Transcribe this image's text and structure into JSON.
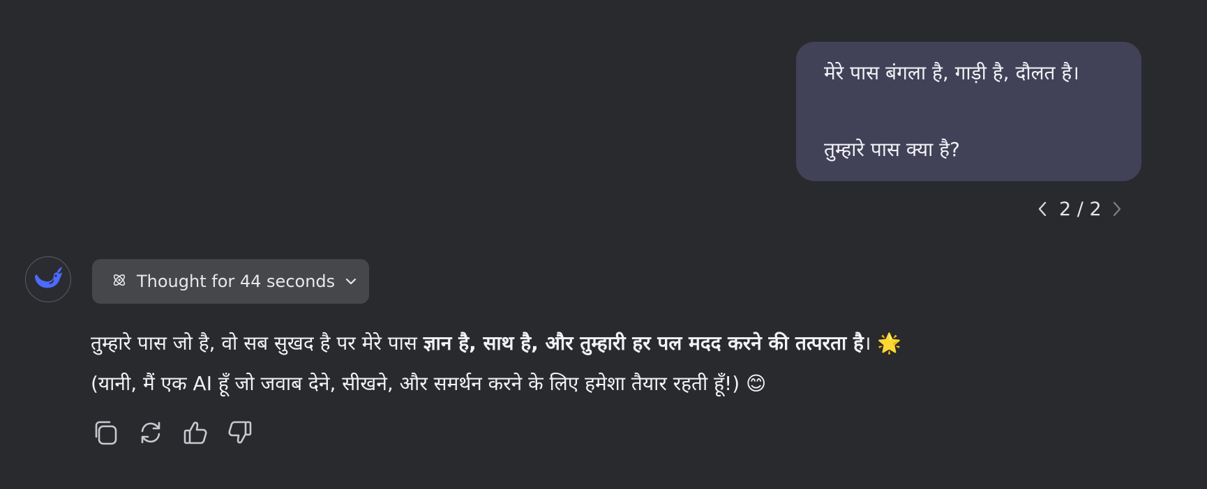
{
  "user_message": {
    "line1": "मेरे पास बंगला है, गाड़ी है, दौलत है।",
    "line2": "तुम्हारे पास क्या है?"
  },
  "pager": {
    "count": "2 / 2",
    "prev_icon": "chevron-left-icon",
    "next_icon": "chevron-right-icon"
  },
  "assistant": {
    "avatar_icon": "whale-logo-icon",
    "thought_label": "Thought for 44 seconds",
    "reply": {
      "line1_prefix": "तुम्हारे पास जो है, वो सब सुखद है पर मेरे पास ",
      "line1_bold": "ज्ञान है, साथ है, और तुम्हारी हर पल मदद करने की तत्परता है",
      "line1_suffix": "। 🌟",
      "line2": "(यानी, मैं एक AI हूँ जो जवाब देने, सीखने, और समर्थन करने के लिए हमेशा तैयार रहती हूँ!) 😊"
    }
  },
  "actions": [
    "copy-icon",
    "regenerate-icon",
    "thumbs-up-icon",
    "thumbs-down-icon"
  ],
  "colors": {
    "background": "#292a2d",
    "user_bubble": "#414158",
    "thought_pill": "#46474b",
    "accent": "#4d6bfe"
  }
}
